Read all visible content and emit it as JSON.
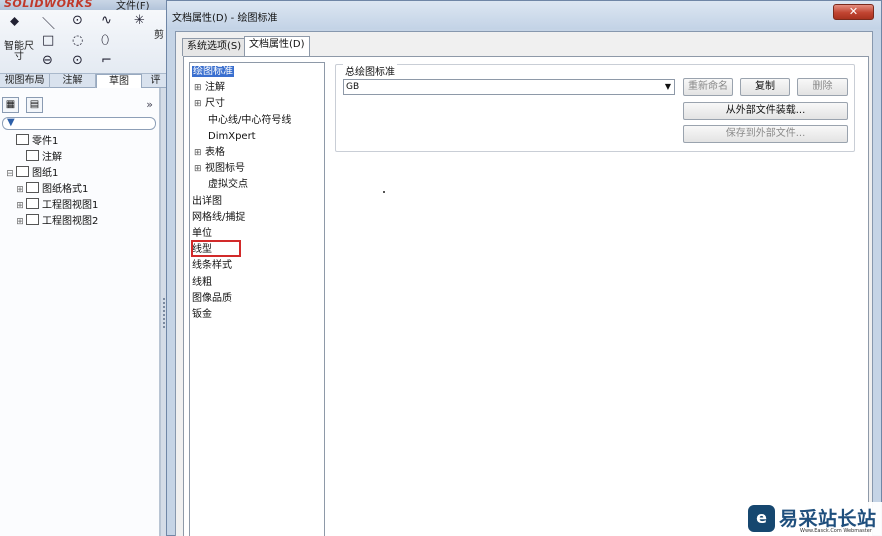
{
  "app": {
    "logo_text": "SOLIDWORKS",
    "file_menu": "文件(F)",
    "ribbon": {
      "smart_dim_label": "智能尺寸",
      "trim_label": "剪"
    },
    "tabs": [
      "视图布局",
      "注解",
      "草图",
      "评"
    ],
    "active_tab_index": 2,
    "tree": [
      {
        "label": "零件1",
        "icon": "part-icon",
        "depth": 0,
        "expander": ""
      },
      {
        "label": "注解",
        "icon": "annotation-icon",
        "depth": 1,
        "expander": ""
      },
      {
        "label": "图纸1",
        "icon": "sheet-icon",
        "depth": 0,
        "expander": "⊟"
      },
      {
        "label": "图纸格式1",
        "icon": "sheet-format-icon",
        "depth": 1,
        "expander": "⊞"
      },
      {
        "label": "工程图视图1",
        "icon": "drawing-view-icon",
        "depth": 1,
        "expander": "⊞"
      },
      {
        "label": "工程图视图2",
        "icon": "drawing-view-icon",
        "depth": 1,
        "expander": "⊞"
      }
    ]
  },
  "dialog": {
    "title": "文档属性(D) - 绘图标准",
    "close_label": "✕",
    "tabs": [
      {
        "label": "系统选项(S)",
        "active": false
      },
      {
        "label": "文档属性(D)",
        "active": true
      }
    ],
    "options": [
      {
        "label": "绘图标准",
        "depth": 0,
        "expander": "",
        "selected": true
      },
      {
        "label": "注解",
        "depth": 1,
        "expander": "⊞",
        "selected": false
      },
      {
        "label": "尺寸",
        "depth": 1,
        "expander": "⊞",
        "selected": false
      },
      {
        "label": "中心线/中心符号线",
        "depth": 1,
        "expander": "",
        "selected": false
      },
      {
        "label": "DimXpert",
        "depth": 1,
        "expander": "",
        "selected": false
      },
      {
        "label": "表格",
        "depth": 1,
        "expander": "⊞",
        "selected": false
      },
      {
        "label": "视图标号",
        "depth": 1,
        "expander": "⊞",
        "selected": false
      },
      {
        "label": "虚拟交点",
        "depth": 1,
        "expander": "",
        "selected": false
      },
      {
        "label": "出详图",
        "depth": 0,
        "expander": "",
        "selected": false
      },
      {
        "label": "网格线/捕捉",
        "depth": 0,
        "expander": "",
        "selected": false
      },
      {
        "label": "单位",
        "depth": 0,
        "expander": "",
        "selected": false
      },
      {
        "label": "线型",
        "depth": 0,
        "expander": "",
        "selected": false,
        "highlighted": true
      },
      {
        "label": "线条样式",
        "depth": 0,
        "expander": "",
        "selected": false
      },
      {
        "label": "线粗",
        "depth": 0,
        "expander": "",
        "selected": false
      },
      {
        "label": "图像品质",
        "depth": 0,
        "expander": "",
        "selected": false
      },
      {
        "label": "钣金",
        "depth": 0,
        "expander": "",
        "selected": false
      }
    ],
    "standard_group": {
      "legend": "总绘图标准",
      "selected_value": "GB",
      "buttons": {
        "rename": "重新命名",
        "copy": "复制",
        "delete": "删除",
        "load_external": "从外部文件装载...",
        "save_external": "保存到外部文件..."
      }
    }
  },
  "watermark": {
    "logo": "e",
    "text": "易采站长站",
    "subtext": "Www.Easck.Com Webmaster"
  },
  "colors": {
    "selection": "#3a6fcf",
    "highlight_box": "#d22a2a",
    "close_button": "#c14431"
  }
}
